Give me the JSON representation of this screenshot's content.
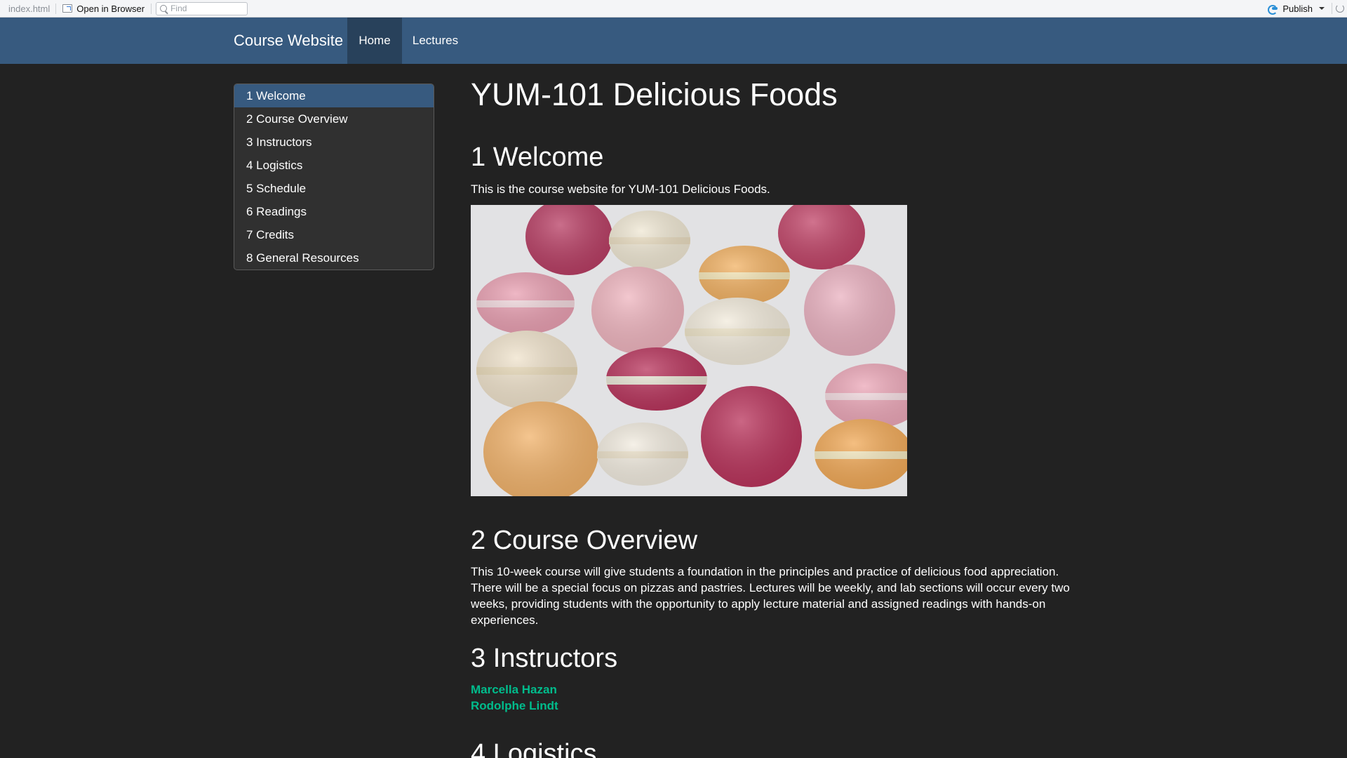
{
  "viewer": {
    "file_name": "index.html",
    "open_in_browser": "Open in Browser",
    "find_placeholder": "Find",
    "publish_label": "Publish"
  },
  "navbar": {
    "brand": "Course Website",
    "items": [
      {
        "label": "Home",
        "active": true
      },
      {
        "label": "Lectures",
        "active": false
      }
    ]
  },
  "toc": {
    "items": [
      {
        "label": "1 Welcome",
        "active": true
      },
      {
        "label": "2 Course Overview"
      },
      {
        "label": "3 Instructors"
      },
      {
        "label": "4 Logistics"
      },
      {
        "label": "5 Schedule"
      },
      {
        "label": "6 Readings"
      },
      {
        "label": "7 Credits"
      },
      {
        "label": "8 General Resources"
      }
    ]
  },
  "content": {
    "title": "YUM-101 Delicious Foods",
    "sections": {
      "welcome": {
        "heading": "1 Welcome",
        "text": "This is the course website for YUM-101 Delicious Foods."
      },
      "overview": {
        "heading": "2 Course Overview",
        "text": "This 10-week course will give students a foundation in the principles and practice of delicious food appreciation. There will be a special focus on pizzas and pastries. Lectures will be weekly, and lab sections will occur every two weeks, providing students with the opportunity to apply lecture material and assigned readings with hands-on experiences."
      },
      "instructors": {
        "heading": "3 Instructors",
        "people": [
          "Marcella Hazan",
          "Rodolphe Lindt"
        ]
      },
      "logistics": {
        "heading": "4 Logistics"
      }
    }
  },
  "colors": {
    "navbar": "#375a7f",
    "navbar_active": "#28415b",
    "background": "#222222",
    "link": "#00bc8c"
  }
}
